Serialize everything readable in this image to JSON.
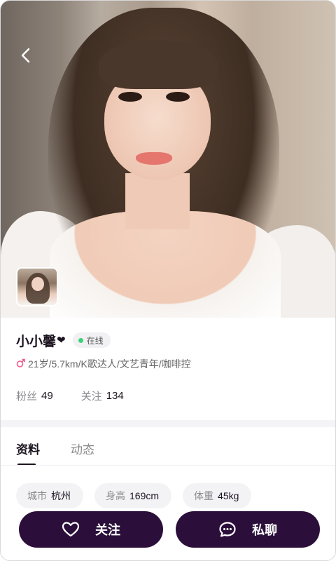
{
  "profile": {
    "name": "小小馨",
    "name_suffix": "❤",
    "online_label": "在线",
    "tags": "21岁/5.7km/K歌达人/文艺青年/咖啡控",
    "gender_icon": "female-icon",
    "stats": {
      "fans_label": "粉丝",
      "fans_value": "49",
      "following_label": "关注",
      "following_value": "134"
    }
  },
  "tabs": [
    {
      "label": "资料",
      "active": true
    },
    {
      "label": "动态",
      "active": false
    }
  ],
  "details": [
    {
      "label": "城市",
      "value": "杭州"
    },
    {
      "label": "身高",
      "value": "169cm"
    },
    {
      "label": "体重",
      "value": "45kg"
    }
  ],
  "actions": {
    "follow_label": "关注",
    "chat_label": "私聊"
  },
  "colors": {
    "button_bg": "#2b0f3a",
    "online_dot": "#3fd07a",
    "gender": "#ee5a8f"
  }
}
